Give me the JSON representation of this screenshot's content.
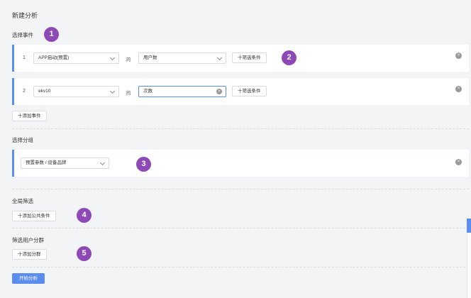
{
  "page_title": "新建分析",
  "sections": {
    "events": "选择事件",
    "group": "选择分组",
    "global_filter": "全局筛选",
    "user_filter": "筛选用户分群"
  },
  "events": [
    {
      "num": "1",
      "event": "APP启动(预置)",
      "de": "的",
      "metric": "用户数",
      "filter_btn": "十筛选条件"
    },
    {
      "num": "2",
      "event": "ekv10",
      "de": "的",
      "metric": "次数",
      "filter_btn": "十筛选条件"
    }
  ],
  "add_event": "十添加事件",
  "group_select": "预置参数 / 设备品牌",
  "add_public_filter": "十添加公共条件",
  "add_segment": "十添加分群",
  "start_button": "开始分析",
  "badges": [
    "1",
    "2",
    "3",
    "4",
    "5"
  ],
  "icons": {
    "close": "×",
    "clear": "×"
  },
  "colors": {
    "accent": "#5b8def",
    "badge": "#8e49b6",
    "background": "#f3f4f6"
  }
}
